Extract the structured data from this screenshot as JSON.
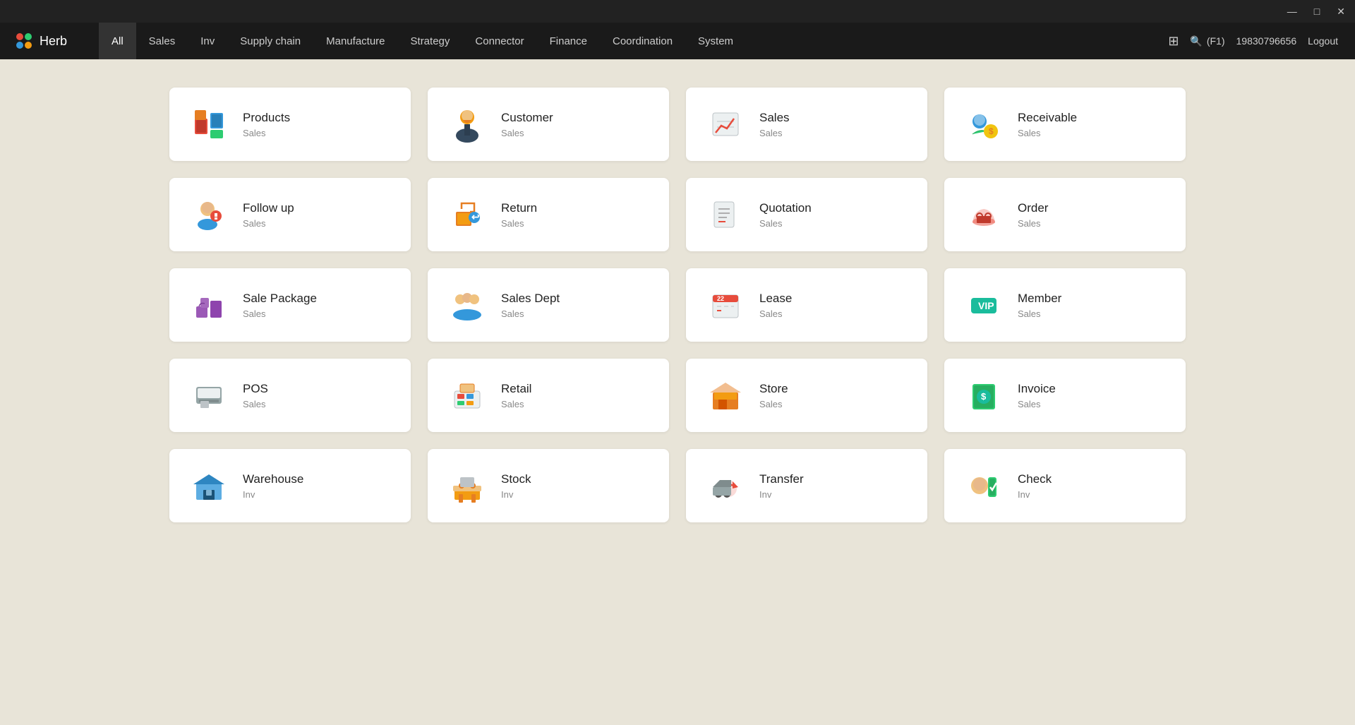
{
  "app": {
    "name": "Herb",
    "user": "19830796656",
    "logout_label": "Logout",
    "search_label": "(F1)"
  },
  "titlebar": {
    "minimize": "—",
    "maximize": "□",
    "close": "✕"
  },
  "nav": {
    "items": [
      {
        "label": "All",
        "active": true
      },
      {
        "label": "Sales"
      },
      {
        "label": "Inv"
      },
      {
        "label": "Supply chain"
      },
      {
        "label": "Manufacture"
      },
      {
        "label": "Strategy"
      },
      {
        "label": "Connector"
      },
      {
        "label": "Finance"
      },
      {
        "label": "Coordination"
      },
      {
        "label": "System"
      }
    ]
  },
  "cards": [
    {
      "title": "Products",
      "category": "Sales",
      "icon": "products"
    },
    {
      "title": "Customer",
      "category": "Sales",
      "icon": "customer"
    },
    {
      "title": "Sales",
      "category": "Sales",
      "icon": "sales"
    },
    {
      "title": "Receivable",
      "category": "Sales",
      "icon": "receivable"
    },
    {
      "title": "Follow up",
      "category": "Sales",
      "icon": "followup"
    },
    {
      "title": "Return",
      "category": "Sales",
      "icon": "return"
    },
    {
      "title": "Quotation",
      "category": "Sales",
      "icon": "quotation"
    },
    {
      "title": "Order",
      "category": "Sales",
      "icon": "order"
    },
    {
      "title": "Sale Package",
      "category": "Sales",
      "icon": "salepackage"
    },
    {
      "title": "Sales Dept",
      "category": "Sales",
      "icon": "salesdept"
    },
    {
      "title": "Lease",
      "category": "Sales",
      "icon": "lease"
    },
    {
      "title": "Member",
      "category": "Sales",
      "icon": "member"
    },
    {
      "title": "POS",
      "category": "Sales",
      "icon": "pos"
    },
    {
      "title": "Retail",
      "category": "Sales",
      "icon": "retail"
    },
    {
      "title": "Store",
      "category": "Sales",
      "icon": "store"
    },
    {
      "title": "Invoice",
      "category": "Sales",
      "icon": "invoice"
    },
    {
      "title": "Warehouse",
      "category": "Inv",
      "icon": "warehouse"
    },
    {
      "title": "Stock",
      "category": "Inv",
      "icon": "stock"
    },
    {
      "title": "Transfer",
      "category": "Inv",
      "icon": "transfer"
    },
    {
      "title": "Check",
      "category": "Inv",
      "icon": "check"
    }
  ]
}
